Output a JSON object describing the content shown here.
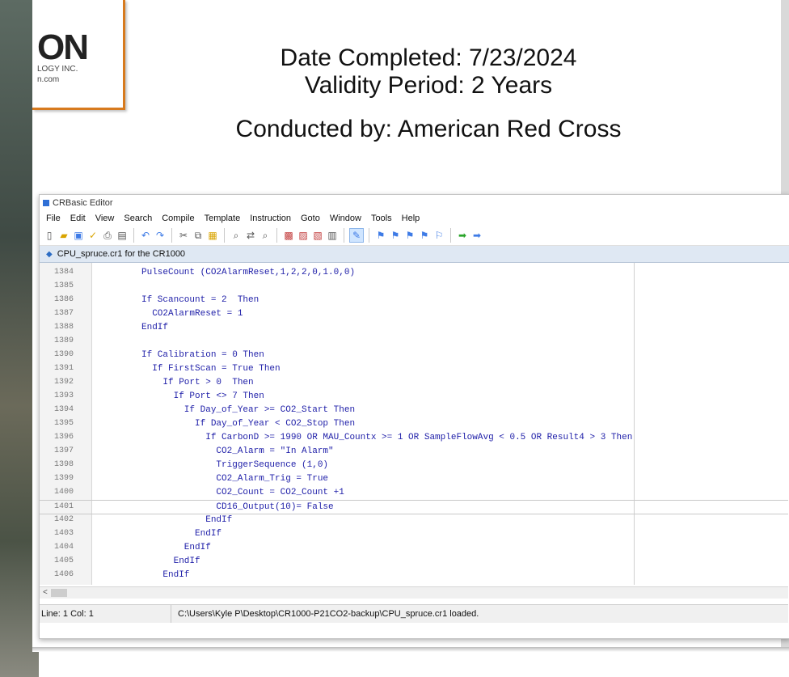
{
  "logo": {
    "big": "ON",
    "line1": "LOGY INC.",
    "line2": "n.com"
  },
  "info": {
    "date_completed": "Date Completed: 7/23/2024",
    "validity": "Validity Period: 2 Years",
    "conducted_by": "Conducted by: American Red Cross"
  },
  "editor": {
    "title": "CRBasic Editor",
    "menu": [
      "File",
      "Edit",
      "View",
      "Search",
      "Compile",
      "Template",
      "Instruction",
      "Goto",
      "Window",
      "Tools",
      "Help"
    ],
    "toolbar_icons": [
      "new-file-icon",
      "open-folder-icon",
      "save-icon",
      "compile-icon",
      "print-icon",
      "print-preview-icon",
      "undo-icon",
      "redo-icon",
      "cut-icon",
      "copy-icon",
      "paste-icon",
      "find-icon",
      "replace-icon",
      "find-next-icon",
      "instruction-icon",
      "template-icon",
      "settings-icon",
      "view-icon",
      "bookmark-icon",
      "flag1-icon",
      "flag2-icon",
      "flag3-icon",
      "flag4-icon",
      "flag-clear-icon",
      "arrow-left-icon",
      "arrow-right-icon"
    ],
    "doc_tab": "CPU_spruce.cr1 for the CR1000",
    "code_lines": [
      {
        "num": "1384",
        "text": "PulseCount (CO2AlarmReset,1,2,2,0,1.0,0)"
      },
      {
        "num": "1385",
        "text": ""
      },
      {
        "num": "1386",
        "text": "If Scancount = 2  Then"
      },
      {
        "num": "1387",
        "text": "  CO2AlarmReset = 1"
      },
      {
        "num": "1388",
        "text": "EndIf"
      },
      {
        "num": "1389",
        "text": ""
      },
      {
        "num": "1390",
        "text": "If Calibration = 0 Then"
      },
      {
        "num": "1391",
        "text": "  If FirstScan = True Then"
      },
      {
        "num": "1392",
        "text": "    If Port > 0  Then"
      },
      {
        "num": "1393",
        "text": "      If Port <> 7 Then"
      },
      {
        "num": "1394",
        "text": "        If Day_of_Year >= CO2_Start Then"
      },
      {
        "num": "1395",
        "text": "          If Day_of_Year < CO2_Stop Then"
      },
      {
        "num": "1396",
        "text": "            If CarbonD >= 1990 OR MAU_Countx >= 1 OR SampleFlowAvg < 0.5 OR Result4 > 3 Then"
      },
      {
        "num": "1397",
        "text": "              CO2_Alarm = \"In Alarm\""
      },
      {
        "num": "1398",
        "text": "              TriggerSequence (1,0)"
      },
      {
        "num": "1399",
        "text": "              CO2_Alarm_Trig = True"
      },
      {
        "num": "1400",
        "text": "              CO2_Count = CO2_Count +1"
      },
      {
        "num": "1401",
        "text": "              CD16_Output(10)= False"
      },
      {
        "num": "1402",
        "text": "            EndIf"
      },
      {
        "num": "1403",
        "text": "          EndIf"
      },
      {
        "num": "1404",
        "text": "        EndIf"
      },
      {
        "num": "1405",
        "text": "      EndIf"
      },
      {
        "num": "1406",
        "text": "    EndIf"
      }
    ],
    "status_left": "Line: 1 Col: 1",
    "status_right": "C:\\Users\\Kyle P\\Desktop\\CR1000-P21CO2-backup\\CPU_spruce.cr1 loaded."
  }
}
